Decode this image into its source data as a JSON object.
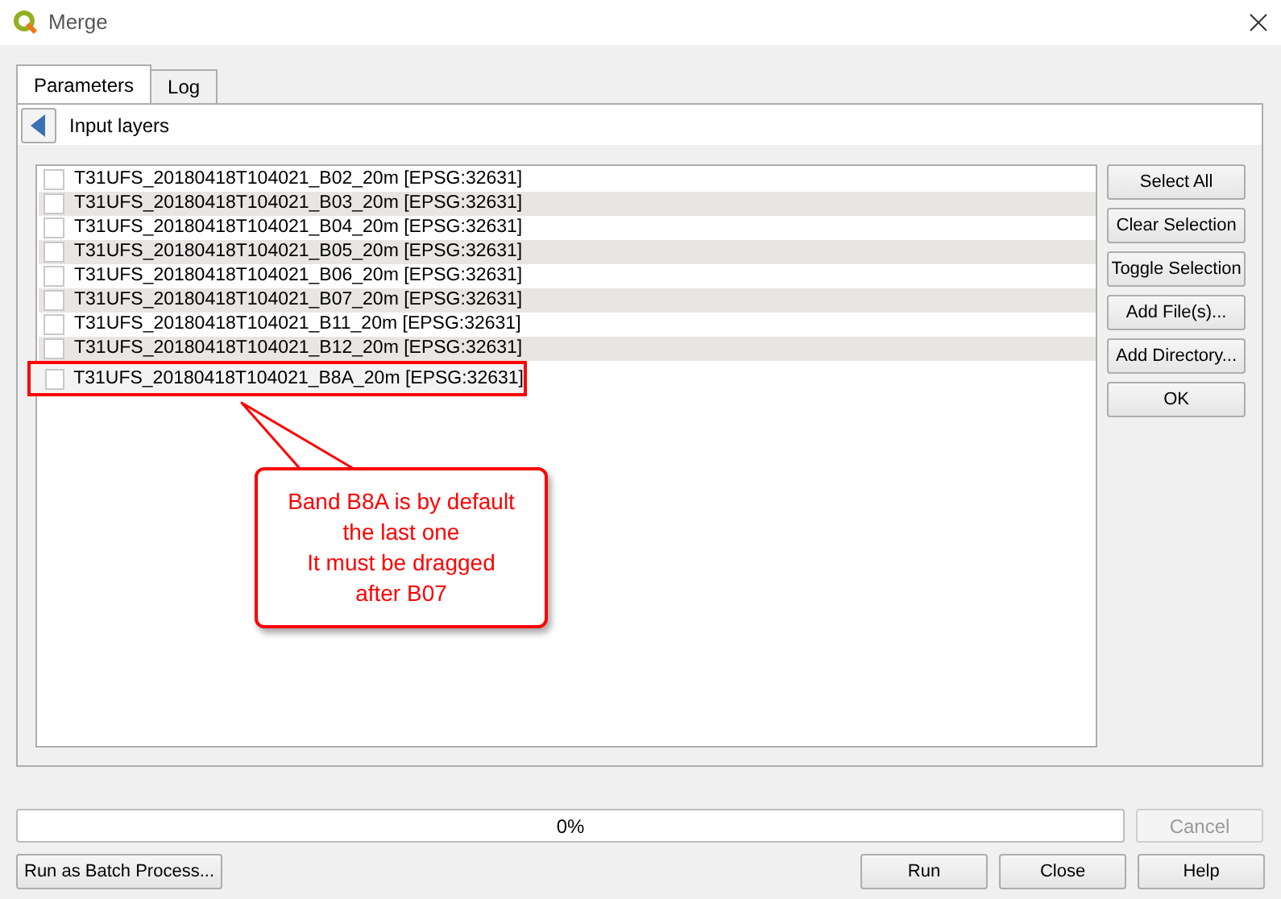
{
  "window": {
    "title": "Merge"
  },
  "tabs": [
    {
      "label": "Parameters",
      "selected": true
    },
    {
      "label": "Log",
      "selected": false
    }
  ],
  "section": {
    "title": "Input layers"
  },
  "layers": [
    {
      "name": "T31UFS_20180418T104021_B02_20m [EPSG:32631]",
      "checked": false
    },
    {
      "name": "T31UFS_20180418T104021_B03_20m [EPSG:32631]",
      "checked": false
    },
    {
      "name": "T31UFS_20180418T104021_B04_20m [EPSG:32631]",
      "checked": false
    },
    {
      "name": "T31UFS_20180418T104021_B05_20m [EPSG:32631]",
      "checked": false
    },
    {
      "name": "T31UFS_20180418T104021_B06_20m [EPSG:32631]",
      "checked": false
    },
    {
      "name": "T31UFS_20180418T104021_B07_20m [EPSG:32631]",
      "checked": false
    },
    {
      "name": "T31UFS_20180418T104021_B11_20m [EPSG:32631]",
      "checked": false
    },
    {
      "name": "T31UFS_20180418T104021_B12_20m [EPSG:32631]",
      "checked": false
    },
    {
      "name": "T31UFS_20180418T104021_B8A_20m [EPSG:32631]",
      "checked": false,
      "highlighted": true
    }
  ],
  "side_buttons": [
    "Select All",
    "Clear Selection",
    "Toggle Selection",
    "Add File(s)...",
    "Add Directory...",
    "OK"
  ],
  "annotation": {
    "lines": [
      "Band B8A is by default",
      "the last one",
      "It must be dragged",
      "after B07"
    ]
  },
  "progress": {
    "level": 0,
    "reading": "0%"
  },
  "cancel_button": {
    "label": "Cancel",
    "disabled": true
  },
  "batch_button": "Run as Batch Process...",
  "buttons": [
    "Run",
    "Close",
    "Help"
  ]
}
